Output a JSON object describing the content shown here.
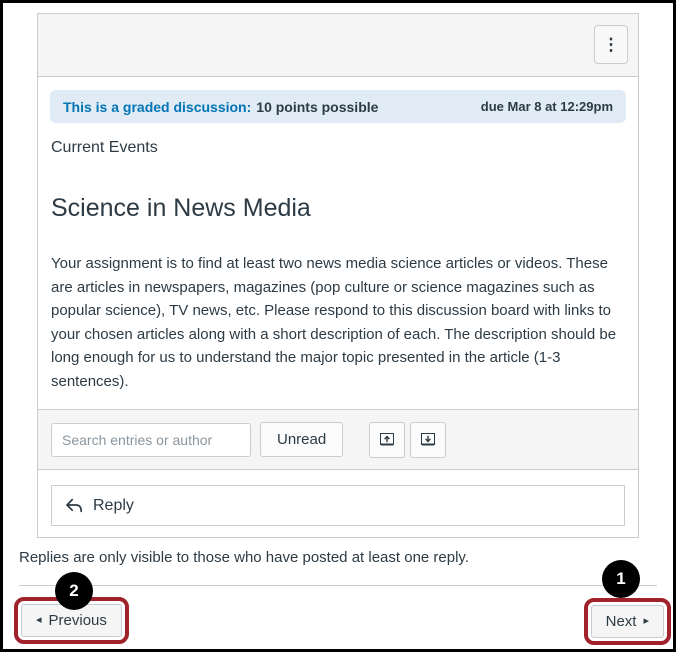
{
  "card": {
    "menu_icon": "⋮"
  },
  "banner": {
    "graded_text": "This is a graded discussion:",
    "points_text": "10 points possible",
    "due_text": "due Mar 8 at 12:29pm"
  },
  "discussion": {
    "context": "Current Events",
    "title": "Science in News Media",
    "description": "Your assignment is to find at least two news media science articles or videos.  These are articles in newspapers, magazines (pop culture or science magazines such as popular science), TV news, etc.  Please respond to this discussion board with links to your chosen articles along with a short description of each.  The description should be long enough for us to understand the major topic presented in the article (1-3 sentences)."
  },
  "toolbar": {
    "search_placeholder": "Search entries or author",
    "unread_button": "Unread",
    "collapse_icon_name": "collapse-replies-icon",
    "expand_icon_name": "expand-replies-icon"
  },
  "reply_box": {
    "label": "Reply"
  },
  "footer": {
    "note": "Replies are only visible to those who have posted at least one reply.",
    "previous_label": "Previous",
    "previous_arrow": "◂",
    "next_label": "Next",
    "next_arrow": "▸"
  },
  "annotations": {
    "step_next": "1",
    "step_previous": "2",
    "highlight_color": "#A0232B",
    "marker_color": "#000000"
  },
  "colors": {
    "link_blue": "#0374B5",
    "banner_bg": "#E0EBF5",
    "text_dark": "#2D3B45",
    "border_gray": "#C7CDD1",
    "panel_gray": "#F5F5F5"
  }
}
